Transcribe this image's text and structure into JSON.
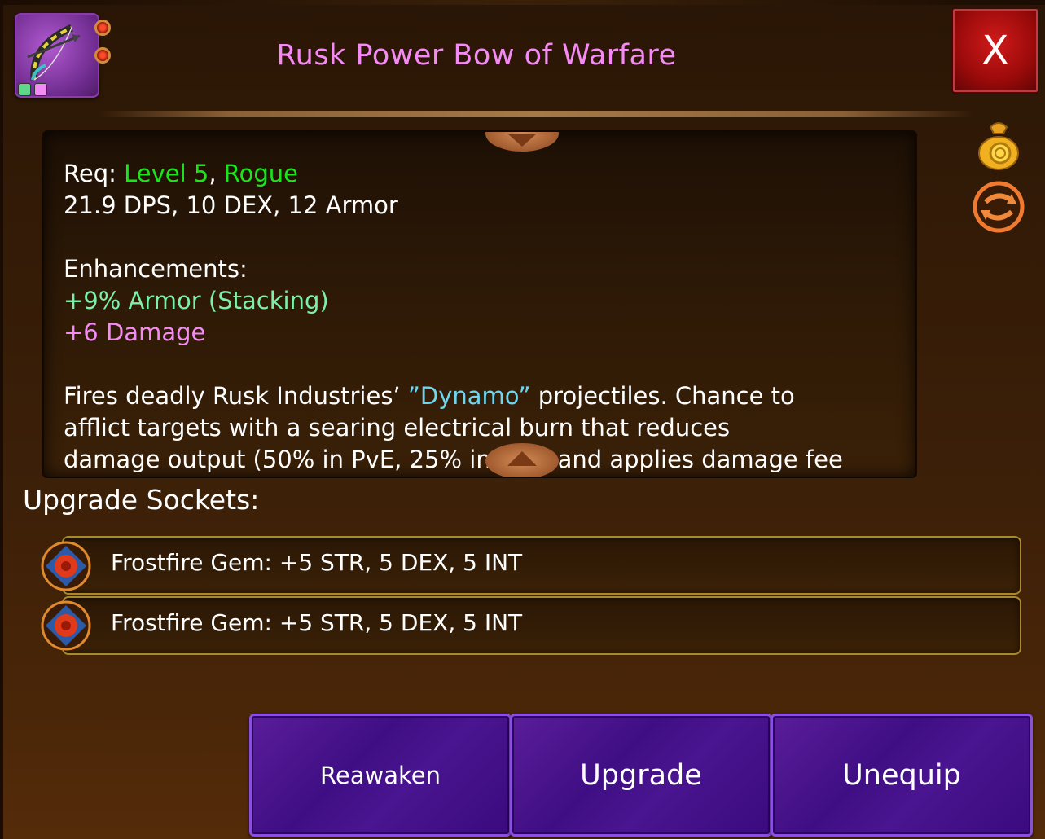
{
  "item": {
    "icon": "bow-icon",
    "title": "Rusk Power Bow of Warfare"
  },
  "close_label": "X",
  "side_icons": [
    "gold-bag-icon",
    "swap-icon"
  ],
  "description": {
    "req_label": "Req: ",
    "req_level": "Level 5",
    "req_sep": ", ",
    "req_class": "Rogue",
    "stats": "21.9 DPS, 10 DEX, 12 Armor",
    "enhancements_label": "Enhancements:",
    "enhancement_1": "+9% Armor (Stacking)",
    "enhancement_2": "+6 Damage",
    "flavor_1": "Fires deadly Rusk Industries’ ",
    "flavor_highlight": "”Dynamo”",
    "flavor_2": " projectiles. Chance to",
    "flavor_line2": "afflict targets with a searing electrical burn that reduces",
    "flavor_line3": "damage output (50% in PvE, 25% in PvP) and applies damage fee"
  },
  "sockets": {
    "label": "Upgrade Sockets:",
    "items": [
      {
        "text": "Frostfire Gem: +5 STR, 5 DEX, 5 INT",
        "icon": "frostfire-gem-icon"
      },
      {
        "text": "Frostfire Gem: +5 STR, 5 DEX, 5 INT",
        "icon": "frostfire-gem-icon"
      }
    ]
  },
  "buttons": {
    "reawaken": "Reawaken",
    "upgrade": "Upgrade",
    "unequip": "Unequip"
  },
  "colors": {
    "title": "#f48af4",
    "req_green": "#19e619",
    "enh_mint": "#7cf0a8",
    "enh_pink": "#f48af4",
    "highlight_cyan": "#6fd6f0",
    "button_purple": "#3f0e84",
    "close_red": "#b01010"
  }
}
